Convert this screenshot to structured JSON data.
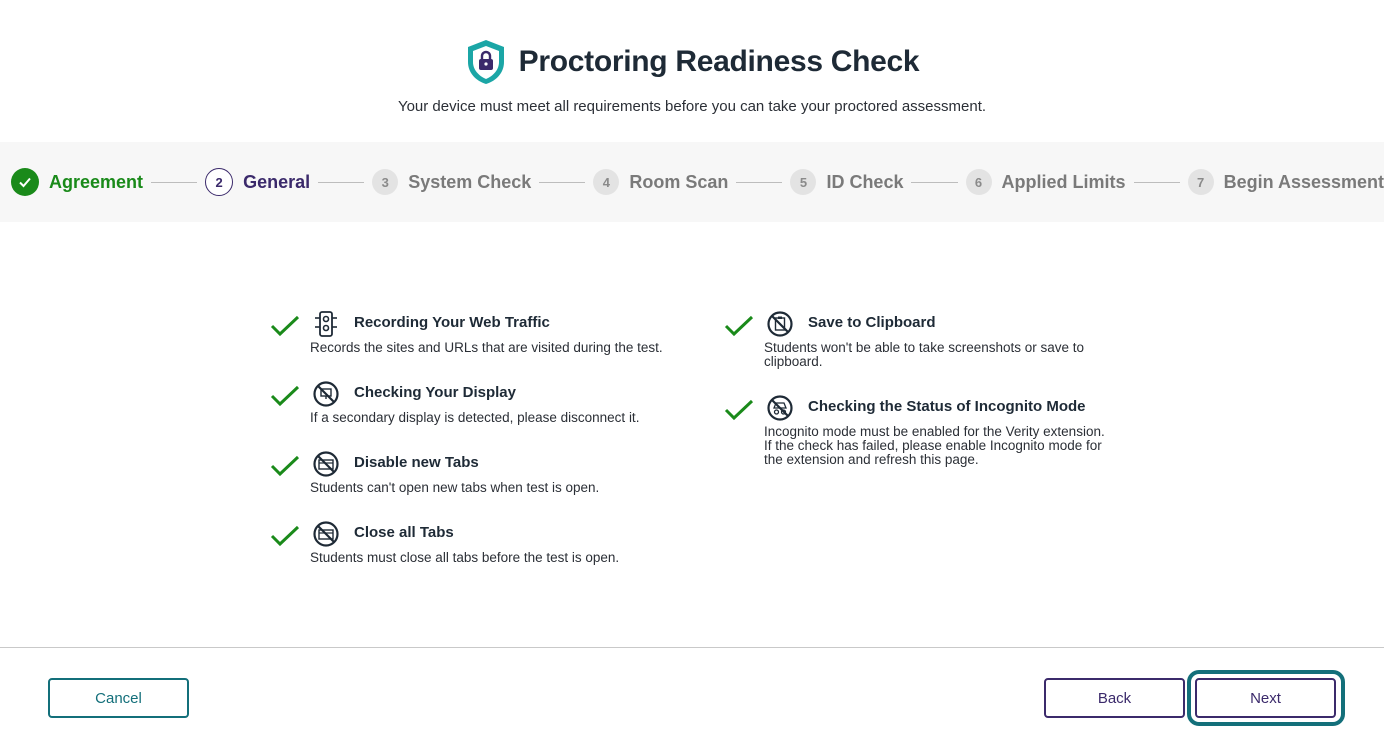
{
  "header": {
    "title": "Proctoring Readiness Check",
    "subtitle": "Your device must meet all requirements before you can take your proctored assessment.",
    "icon": "shield-lock-icon"
  },
  "steps": [
    {
      "number": "",
      "label": "Agreement",
      "state": "done"
    },
    {
      "number": "2",
      "label": "General",
      "state": "current"
    },
    {
      "number": "3",
      "label": "System Check",
      "state": "todo"
    },
    {
      "number": "4",
      "label": "Room Scan",
      "state": "todo"
    },
    {
      "number": "5",
      "label": "ID Check",
      "state": "todo"
    },
    {
      "number": "6",
      "label": "Applied Limits",
      "state": "todo"
    },
    {
      "number": "7",
      "label": "Begin Assessment",
      "state": "todo"
    }
  ],
  "requirements": {
    "left": [
      {
        "icon": "traffic-light-icon",
        "title": "Recording Your Web Traffic",
        "desc": "Records the sites and URLs that are visited during the test.",
        "status": "passed"
      },
      {
        "icon": "no-display-icon",
        "title": "Checking Your Display",
        "desc": "If a secondary display is detected, please disconnect it.",
        "status": "passed"
      },
      {
        "icon": "no-new-tabs-icon",
        "title": "Disable new Tabs",
        "desc": "Students can't open new tabs when test is open.",
        "status": "passed"
      },
      {
        "icon": "no-tabs-icon",
        "title": "Close all Tabs",
        "desc": "Students must close all tabs before the test is open.",
        "status": "passed"
      }
    ],
    "right": [
      {
        "icon": "no-clipboard-icon",
        "title": "Save to Clipboard",
        "desc_lines": [
          "Students won't be able to take screenshots or save to",
          "clipboard."
        ],
        "status": "passed"
      },
      {
        "icon": "no-incognito-icon",
        "title": "Checking the Status of Incognito Mode",
        "desc_lines": [
          "Incognito mode must be enabled for the Verity extension.",
          "If the check has failed, please enable Incognito mode for",
          "the extension and refresh this page."
        ],
        "status": "passed"
      }
    ]
  },
  "footer": {
    "cancel_label": "Cancel",
    "back_label": "Back",
    "next_label": "Next"
  },
  "colors": {
    "done": "#1a8a1a",
    "current": "#3b2a6b",
    "accent": "#136f7a"
  }
}
